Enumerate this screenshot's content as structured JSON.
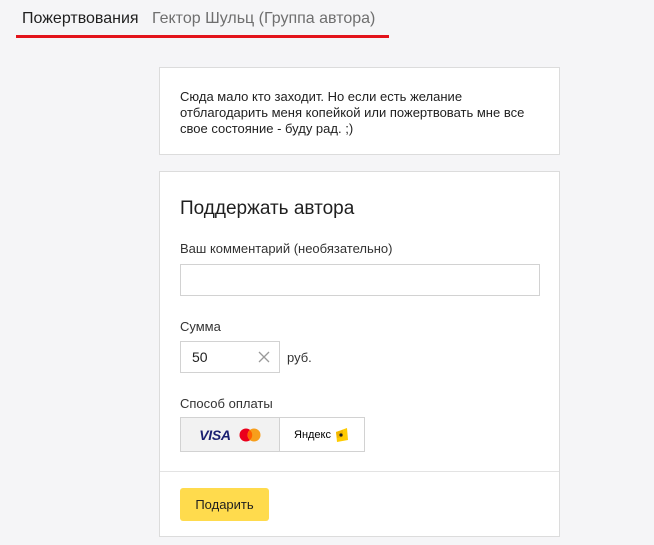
{
  "tabs": {
    "active": "Пожертвования",
    "second": "Гектор Шульц (Группа автора)"
  },
  "info": {
    "text": "Сюда мало кто заходит. Но если есть желание отблагодарить меня копейкой или пожертвовать мне все свое состояние - буду рад. ;)"
  },
  "form": {
    "title": "Поддержать автора",
    "comment_label": "Ваш комментарий (необязательно)",
    "comment_value": "",
    "sum_label": "Сумма",
    "sum_value": "50",
    "currency": "руб.",
    "payment_label": "Способ оплаты",
    "payment_options": {
      "card": "VISA",
      "yandex": "Яндекс"
    },
    "submit_label": "Подарить"
  },
  "colors": {
    "accent_red": "#e3131b",
    "button_yellow": "#ffdb4d"
  }
}
